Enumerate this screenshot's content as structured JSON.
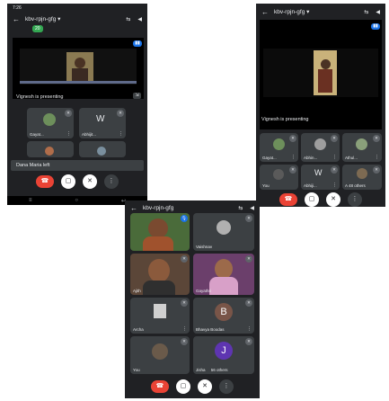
{
  "phone1": {
    "status_time": "7:26",
    "meeting_code": "kbv-rpjn-gfg",
    "caret": "▾",
    "badge": "20",
    "presenting_text": "Vignesh is presenting",
    "participants": [
      {
        "name": "Gayat...",
        "icon": "avatar-photo"
      },
      {
        "name": "Abhijit...",
        "icon": "avatar-logo"
      }
    ],
    "notice": "Dana Maria left"
  },
  "phone2": {
    "meeting_code": "kbv-rpjn-gfg",
    "caret": "▾",
    "presenting_text": "Vignesh is presenting",
    "participants": [
      {
        "name": "Gayat..."
      },
      {
        "name": "Abhin..."
      },
      {
        "name": "Athul..."
      },
      {
        "name": "You"
      },
      {
        "name": "Abhiji..."
      },
      {
        "name": "A 48 others"
      }
    ]
  },
  "phone3": {
    "meeting_code": "kbv-rpjn-gfg",
    "participants": [
      {
        "name": ""
      },
      {
        "name": "Vaishnav"
      },
      {
        "name": "Ajith"
      },
      {
        "name": "Gayathri"
      },
      {
        "name": "Archa"
      },
      {
        "name": "Bhavya Boodas",
        "letter": "B"
      },
      {
        "name": "You"
      },
      {
        "name": "56 others",
        "letter": "J",
        "sub": "Jisha"
      }
    ]
  },
  "colors": {
    "background": "#202124",
    "tile": "#3c4043",
    "end_call": "#ea4335",
    "accent": "#1a73e8",
    "badge": "#34a853",
    "avatar_b": "#795548",
    "avatar_j": "#5e35b1"
  },
  "icons": {
    "back": "←",
    "camera_switch": "⇆",
    "speaker": "◀",
    "end_call": "☎",
    "camera": "▢",
    "mic": "🎙",
    "more": "⋮",
    "mic_off": "✕"
  }
}
